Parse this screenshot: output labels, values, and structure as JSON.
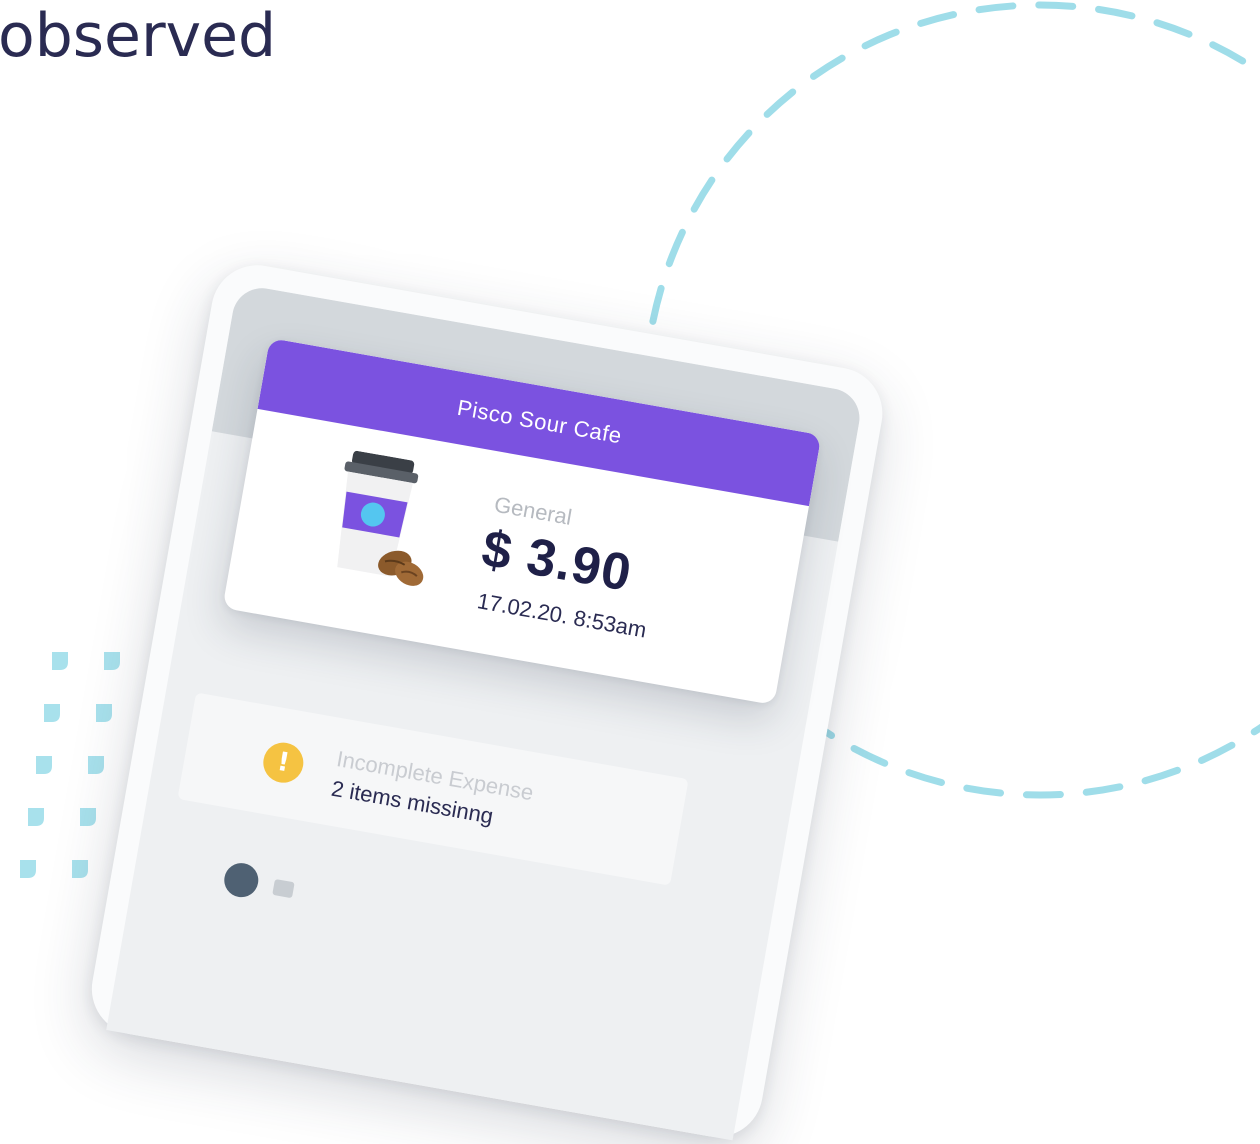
{
  "heading": "observed",
  "receipt": {
    "merchant": "Pisco Sour Cafe",
    "category": "General",
    "amount": "$ 3.90",
    "datetime": "17.02.20. 8:53am"
  },
  "expense_row": {
    "title": "Incomplete Expense",
    "subtitle": "2 items missinng"
  },
  "icons": {
    "warning": "exclamation-icon",
    "cup": "coffee-cup-icon"
  },
  "colors": {
    "brand_purple": "#7b52e0",
    "accent_cyan": "#9fdde9",
    "warning_yellow": "#f5c342",
    "text_navy": "#2a2b52"
  }
}
